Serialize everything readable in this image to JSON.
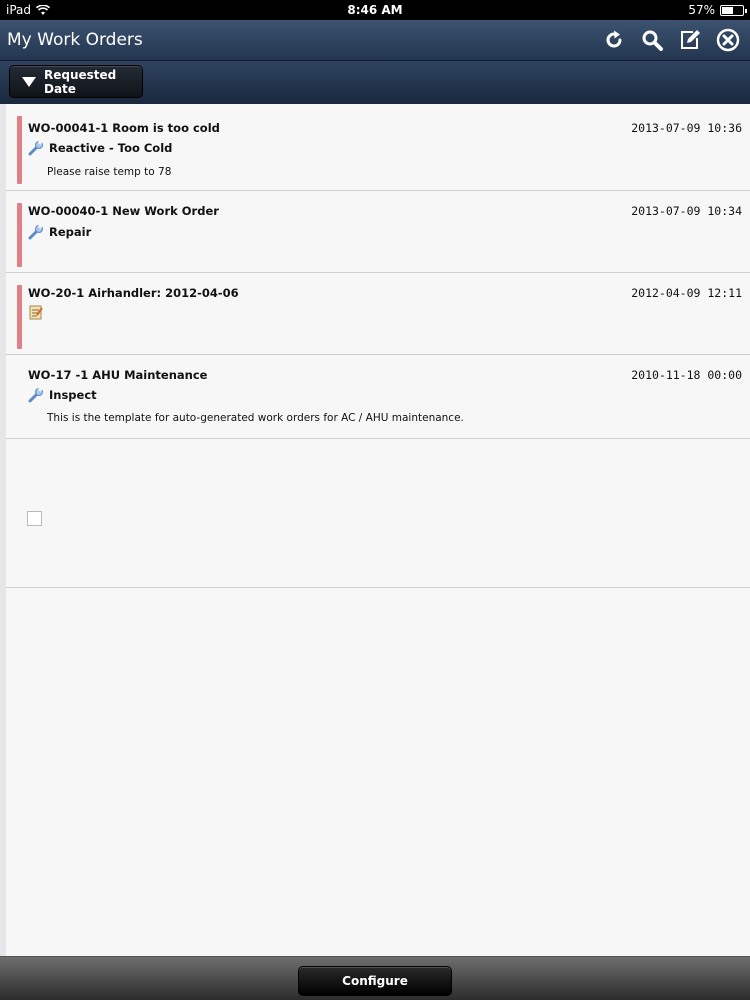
{
  "status_bar": {
    "device": "iPad",
    "time": "8:46 AM",
    "battery": "57%",
    "battery_level": 0.57
  },
  "nav": {
    "title": "My Work Orders",
    "icons": [
      "refresh-icon",
      "search-icon",
      "compose-icon",
      "close-icon"
    ]
  },
  "toolbar": {
    "sort_label": "Requested Date"
  },
  "work_orders": [
    {
      "title": "WO-00041-1  Room is too cold",
      "date": "2013-07-09 10:36",
      "type": "Reactive - Too Cold",
      "description": "Please raise temp to 78",
      "icon": "wrench-icon",
      "flag": true
    },
    {
      "title": "WO-00040-1  New Work Order",
      "date": "2013-07-09 10:34",
      "type": "Repair",
      "description": "",
      "icon": "wrench-icon",
      "flag": true
    },
    {
      "title": "WO-20-1  Airhandler: 2012-04-06",
      "date": "2012-04-09 12:11",
      "type": "",
      "description": "",
      "icon": "notepad-icon",
      "flag": true
    },
    {
      "title": "WO-17 -1  AHU Maintenance",
      "date": "2010-11-18 00:00",
      "type": "Inspect",
      "description": "This is the template for auto-generated work orders for AC / AHU maintenance.",
      "icon": "wrench-icon",
      "flag": false
    }
  ],
  "bottom_bar": {
    "configure_label": "Configure"
  },
  "colors": {
    "nav_bg": "#2f4360",
    "flag": "#e07f86",
    "list_bg": "#f7f7f8"
  }
}
